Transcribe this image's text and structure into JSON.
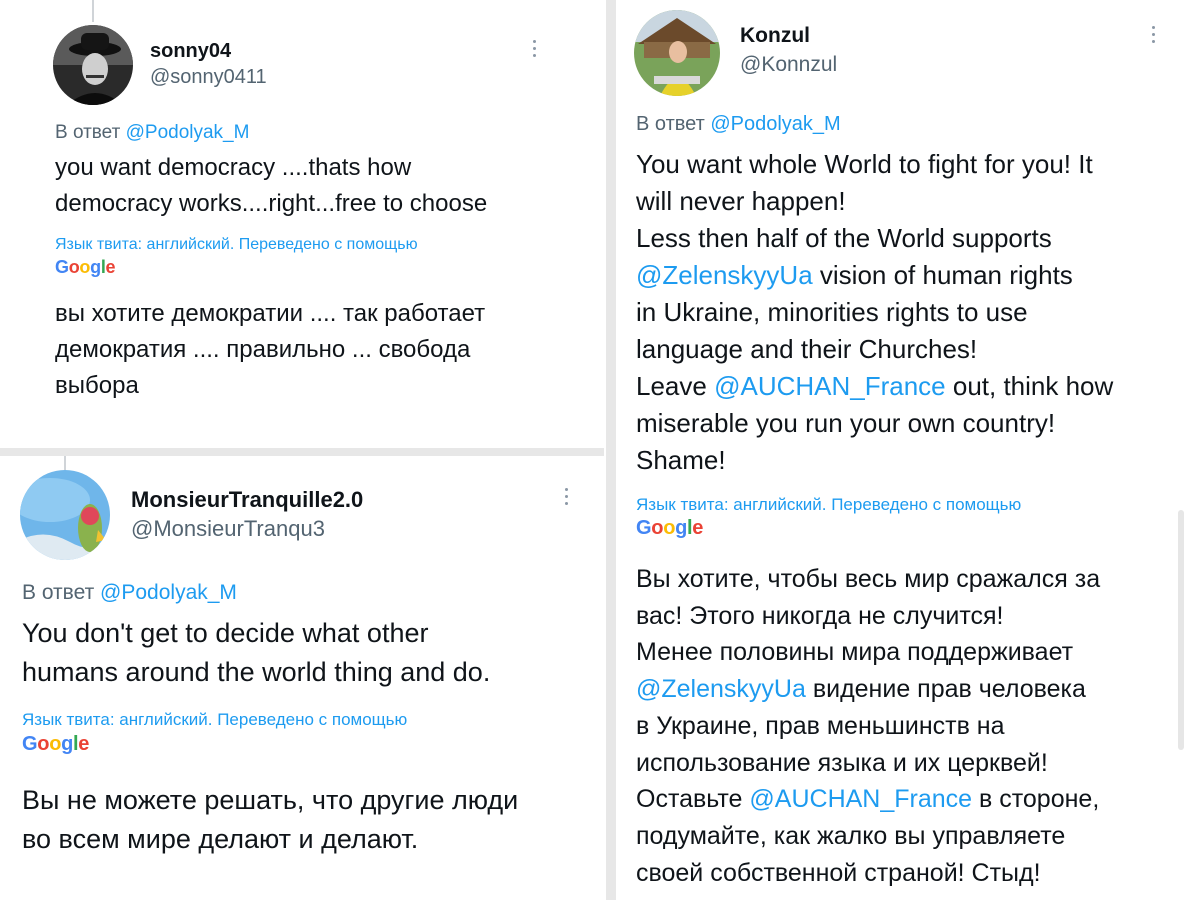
{
  "colors": {
    "mention": "#1d9bf0",
    "text": "#0f1419",
    "secondary": "#536471",
    "divider": "#e7e7e7"
  },
  "tweets": [
    {
      "display_name": "sonny04",
      "handle": "@sonny0411",
      "reply_prefix": "В ответ",
      "reply_to": "@Podolyak_M",
      "body": [
        "you want democracy ....thats how",
        "democracy works....right...free to choose"
      ],
      "translation_note": "Язык твита: английский. Переведено с помощью",
      "translator": "Google",
      "translated": [
        "вы хотите демократии .... так работает",
        "демократия .... правильно ... свобода",
        "выбора"
      ]
    },
    {
      "display_name": "MonsieurTranquille2.0",
      "handle": "@MonsieurTranqu3",
      "reply_prefix": "В ответ",
      "reply_to": "@Podolyak_M",
      "body": [
        "You don't get to decide what other",
        "humans around the world thing and do."
      ],
      "translation_note": "Язык твита: английский. Переведено с помощью",
      "translator": "Google",
      "translated": [
        "Вы не можете решать, что другие люди",
        "во всем мире делают и делают."
      ]
    },
    {
      "display_name": "Konzul",
      "handle": "@Konnzul",
      "reply_prefix": "В ответ",
      "reply_to": "@Podolyak_M",
      "body": [
        "You want whole World to fight for you! It",
        "will never happen!",
        "Less then half of the World supports",
        "@ZelenskyyUa| vision of human rights",
        "in Ukraine, minorities rights to use",
        "language and their Churches!",
        "Leave |@AUCHAN_France| out, think how",
        "miserable you run your own country!",
        "Shame!"
      ],
      "translation_note": "Язык твита: английский. Переведено с помощью",
      "translator": "Google",
      "translated": [
        "Вы хотите, чтобы весь мир сражался за",
        "вас! Этого никогда не случится!",
        "Менее половины мира поддерживает",
        "@ZelenskyyUa| видение прав человека",
        "в Украине, прав меньшинств на",
        "использование языка и их церквей!",
        "Оставьте |@AUCHAN_France| в стороне,",
        "подумайте, как жалко вы управляете",
        "своей собственной страной! Стыд!"
      ]
    }
  ]
}
